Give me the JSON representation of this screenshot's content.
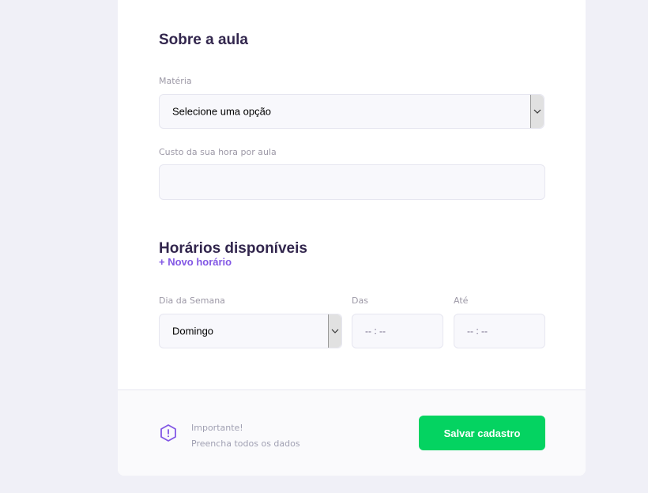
{
  "about_section": {
    "title": "Sobre a aula",
    "subject": {
      "label": "Matéria",
      "selected": "Selecione uma opção"
    },
    "cost": {
      "label": "Custo da sua hora por aula",
      "value": ""
    }
  },
  "schedule_section": {
    "title": "Horários disponíveis",
    "add_link": "+ Novo horário",
    "weekday": {
      "label": "Dia da Semana",
      "selected": "Domingo"
    },
    "from": {
      "label": "Das",
      "value": "-- : --"
    },
    "to": {
      "label": "Até",
      "value": "-- : --"
    }
  },
  "footer": {
    "warning_title": "Importante!",
    "warning_text": "Preencha todos os dados",
    "warning_icon": "warning-icon",
    "save_label": "Salvar cadastro"
  },
  "colors": {
    "page_bg": "#f0f0f7",
    "title": "#32264d",
    "accent": "#8257e5",
    "save_button": "#04d361"
  }
}
